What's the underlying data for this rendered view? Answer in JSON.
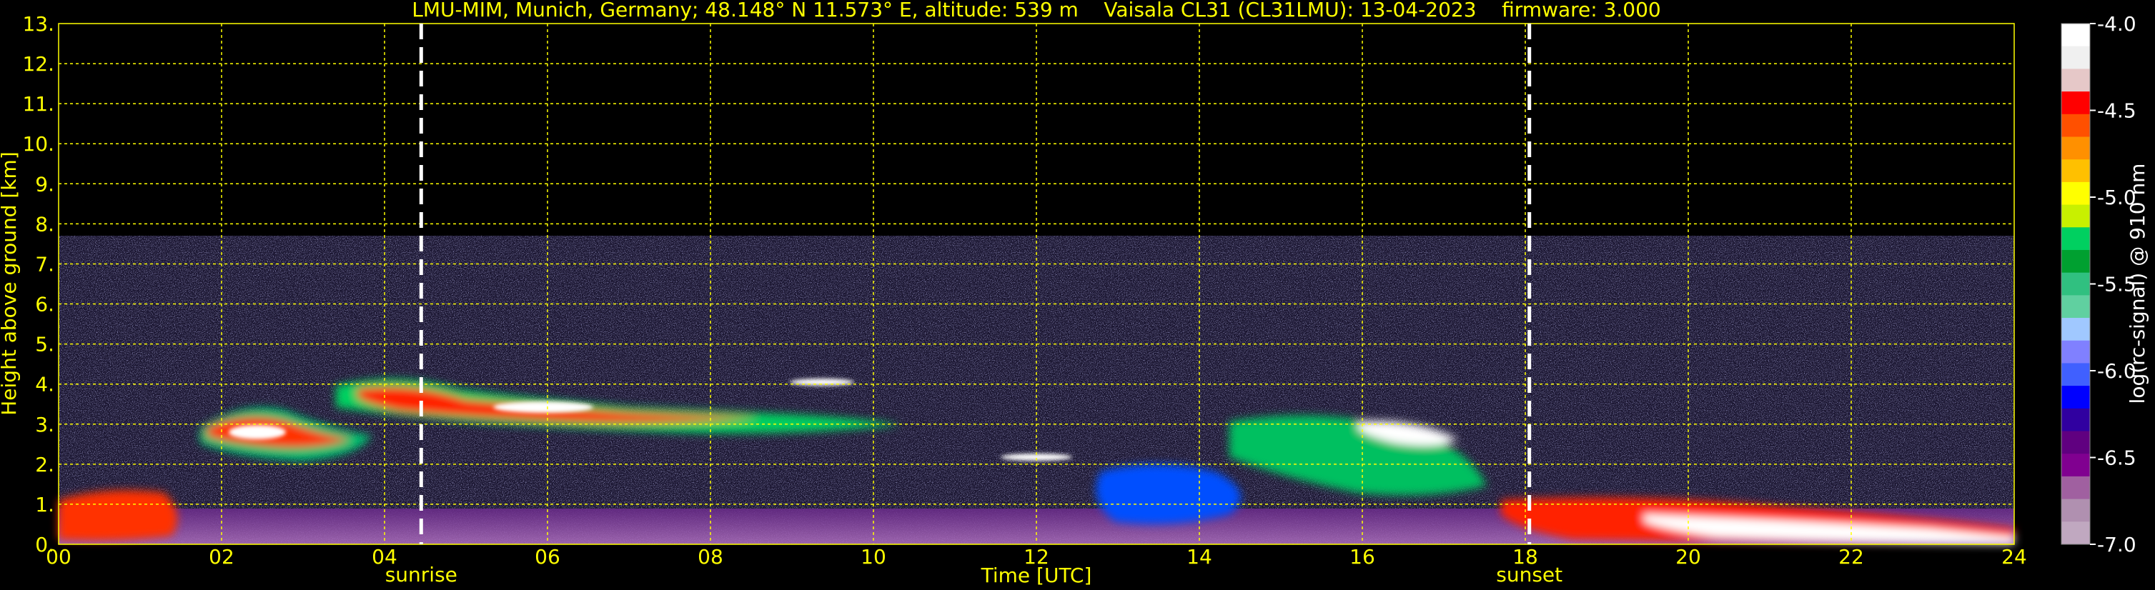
{
  "chart_data": {
    "type": "heatmap",
    "title": "LMU-MIM, Munich, Germany; 48.148° N 11.573° E, altitude: 539 m    Vaisala CL31 (CL31LMU): 13-04-2023    firmware: 3.000",
    "xlabel": "Time [UTC]",
    "ylabel": "Height above ground [km]",
    "xlim": [
      0,
      24
    ],
    "ylim": [
      0,
      13
    ],
    "x_ticks": [
      "00",
      "02",
      "04",
      "06",
      "08",
      "10",
      "12",
      "14",
      "16",
      "18",
      "20",
      "22",
      "24"
    ],
    "y_ticks": [
      "0.",
      "1.",
      "2.",
      "3.",
      "4.",
      "5.",
      "6.",
      "7.",
      "8.",
      "9.",
      "10.",
      "11.",
      "12.",
      "13."
    ],
    "grid": true,
    "annotations": [
      {
        "label": "sunrise",
        "x": 4.45
      },
      {
        "label": "sunset",
        "x": 18.05
      }
    ],
    "colorbar": {
      "label": "log(rc-signal) @ 910 nm",
      "range": [
        -7.0,
        -4.0
      ],
      "ticks": [
        "-4.0",
        "-4.5",
        "-5.0",
        "-5.5",
        "-6.0",
        "-6.5",
        "-7.0"
      ],
      "colors": [
        "#ffffff",
        "#f0f0f0",
        "#e6c8c8",
        "#ff0000",
        "#ff5000",
        "#ff9000",
        "#ffc000",
        "#ffff00",
        "#c8f000",
        "#00d060",
        "#00a030",
        "#30c080",
        "#60d0a0",
        "#a0c8ff",
        "#8080ff",
        "#4060ff",
        "#0000ff",
        "#3000a0",
        "#600080",
        "#800090",
        "#a060a0",
        "#b090b0",
        "#c0a8c0"
      ]
    }
  },
  "colors": {
    "text": "#ffff00",
    "grid": "#ffff00",
    "background": "#000000",
    "marker": "#ffffff"
  }
}
